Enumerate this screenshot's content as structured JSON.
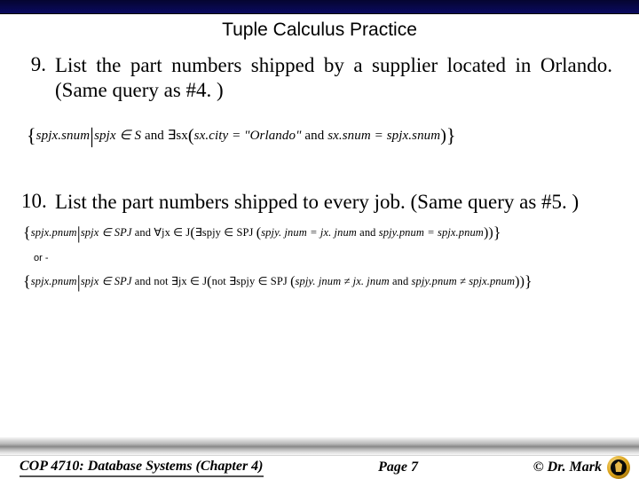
{
  "title": "Tuple Calculus Practice",
  "items": [
    {
      "num": "9.",
      "text": "List the part numbers shipped by a supplier located in Orlando. (Same query as #4. )"
    },
    {
      "num": "10.",
      "text": "List the part numbers shipped to every job. (Same query as #5. )"
    }
  ],
  "formulas": {
    "f9_a": "spjx.snum",
    "f9_b": "spjx ∈ S",
    "f9_c": "∃sx",
    "f9_d": "sx.city = \"Orlando\"",
    "f9_e": "sx.snum = spjx.snum",
    "f10a_a": "spjx.pnum",
    "f10a_b": "spjx ∈ SPJ",
    "f10a_c": "∀jx ∈ J",
    "f10a_d": "∃spjy ∈ SPJ",
    "f10a_e": "spjy. jnum = jx. jnum",
    "f10a_f": "spjy.pnum = spjx.pnum",
    "f10b_a": "spjx.pnum",
    "f10b_b": "spjx ∈ SPJ",
    "f10b_c": "∃jx ∈ J",
    "f10b_d": "∃spjy ∈ SPJ",
    "f10b_e": "spjy. jnum ≠ jx. jnum",
    "f10b_f": "spjy.pnum ≠ spjx.pnum"
  },
  "or_label": "or -",
  "and": " and ",
  "not": "not ",
  "footer": {
    "left": "COP 4710: Database Systems  (Chapter 4)",
    "mid": "Page 7",
    "right": "© Dr. Mark"
  }
}
